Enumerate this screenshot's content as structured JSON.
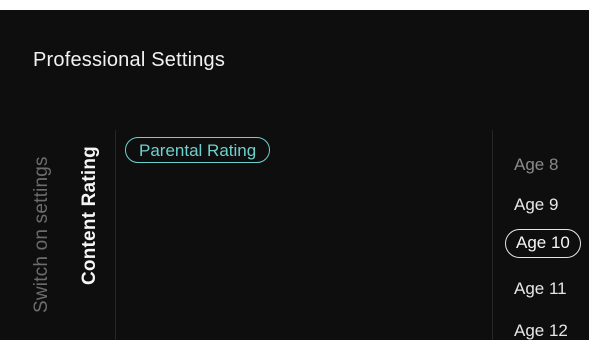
{
  "title_peek": "",
  "screen": {
    "title": "Professional Settings"
  },
  "side_menu": {
    "items": [
      {
        "label": "Switch on settings",
        "state": "inactive"
      },
      {
        "label": "Content Rating",
        "state": "active"
      }
    ]
  },
  "content": {
    "options": [
      {
        "label": "Parental Rating",
        "selected": true
      }
    ]
  },
  "age_list": {
    "items": [
      {
        "label": "Age 8",
        "state": "dim"
      },
      {
        "label": "Age 9",
        "state": "normal"
      },
      {
        "label": "Age 10",
        "state": "selected"
      },
      {
        "label": "Age 11",
        "state": "normal"
      },
      {
        "label": "Age 12",
        "state": "normal"
      }
    ]
  },
  "colors": {
    "background": "#0e0e0e",
    "accent": "#6fd0cc",
    "text": "#f2f2f2",
    "dim_text": "#6c6c6c",
    "header_peek": "#3d6fb6"
  }
}
